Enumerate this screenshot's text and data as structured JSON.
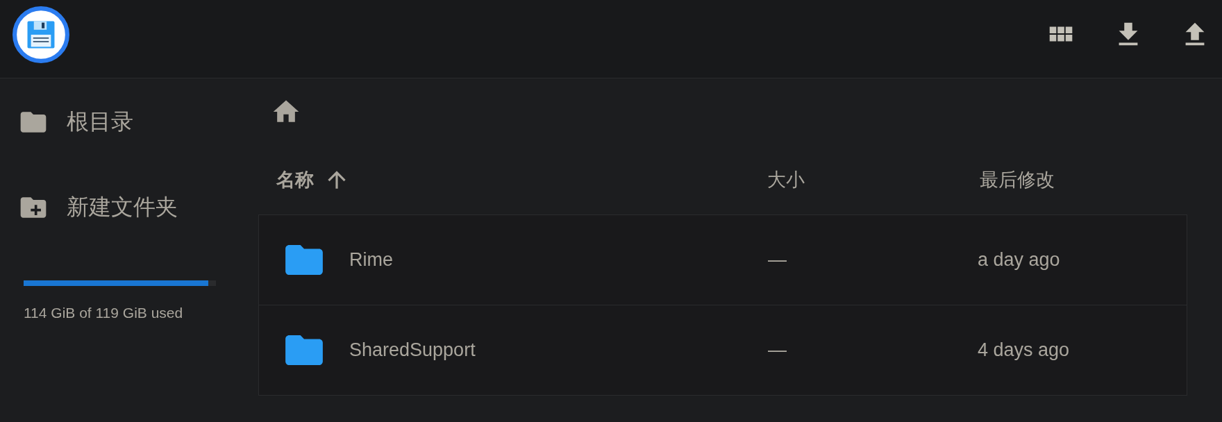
{
  "sidebar": {
    "items": [
      {
        "label": "根目录",
        "kind": "folder"
      },
      {
        "label": "新建文件夹",
        "kind": "new-folder"
      }
    ],
    "storage": {
      "level": 0.96,
      "text": "114 GiB of 119 GiB used"
    }
  },
  "table": {
    "columns": [
      {
        "label": "名称",
        "sorted": true
      },
      {
        "label": "大小",
        "sorted": false
      },
      {
        "label": "最后修改",
        "sorted": false
      }
    ],
    "rows": [
      {
        "name": "Rime",
        "size": "—",
        "modified": "a day ago"
      },
      {
        "name": "SharedSupport",
        "size": "—",
        "modified": "4 days ago"
      }
    ]
  }
}
